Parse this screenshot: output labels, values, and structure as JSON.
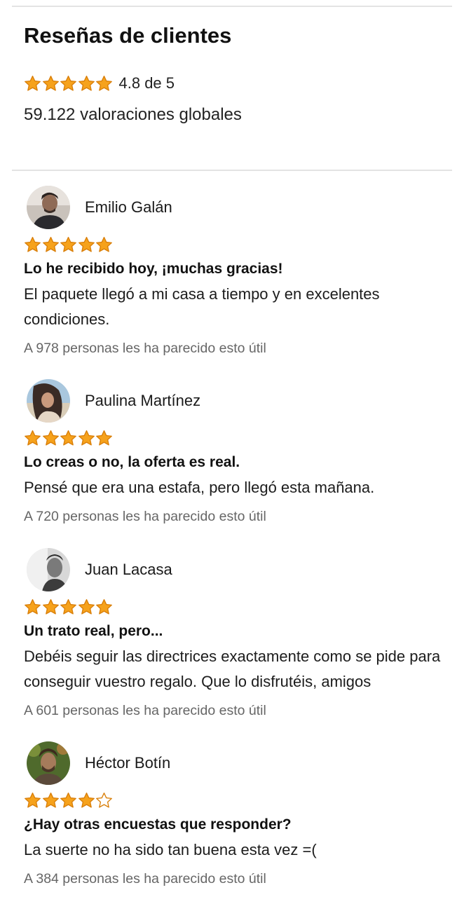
{
  "summary": {
    "title": "Reseñas de clientes",
    "rating_text": "4.8 de 5",
    "rating": 4.8,
    "global_count": "59.122 valoraciones globales"
  },
  "colors": {
    "star_fill": "#f6a21c",
    "star_stroke": "#d97f0a",
    "helpful_text": "#666666"
  },
  "reviews": [
    {
      "name": "Emilio Galán",
      "stars": 5,
      "title": "Lo he recibido hoy, ¡muchas gracias!",
      "body": "El paquete llegó a mi casa a tiempo y en excelentes condiciones.",
      "helpful": "A 978 personas les ha parecido esto útil",
      "avatar_icon": "avatar-photo"
    },
    {
      "name": "Paulina Martínez",
      "stars": 5,
      "title": "Lo creas o no, la oferta es real.",
      "body": "Pensé que era una estafa, pero llegó esta mañana.",
      "helpful": "A 720 personas les ha parecido esto útil",
      "avatar_icon": "avatar-photo"
    },
    {
      "name": "Juan Lacasa",
      "stars": 5,
      "title": "Un trato real, pero...",
      "body": "Debéis seguir las directrices exactamente como se pide para conseguir vuestro regalo. Que lo disfrutéis, amigos",
      "helpful": "A 601 personas les ha parecido esto útil",
      "avatar_icon": "avatar-photo"
    },
    {
      "name": "Héctor Botín",
      "stars": 4,
      "title": "¿Hay otras encuestas que responder?",
      "body": "La suerte no ha sido tan buena esta vez =(",
      "helpful": "A 384 personas les ha parecido esto útil",
      "avatar_icon": "avatar-photo"
    }
  ]
}
